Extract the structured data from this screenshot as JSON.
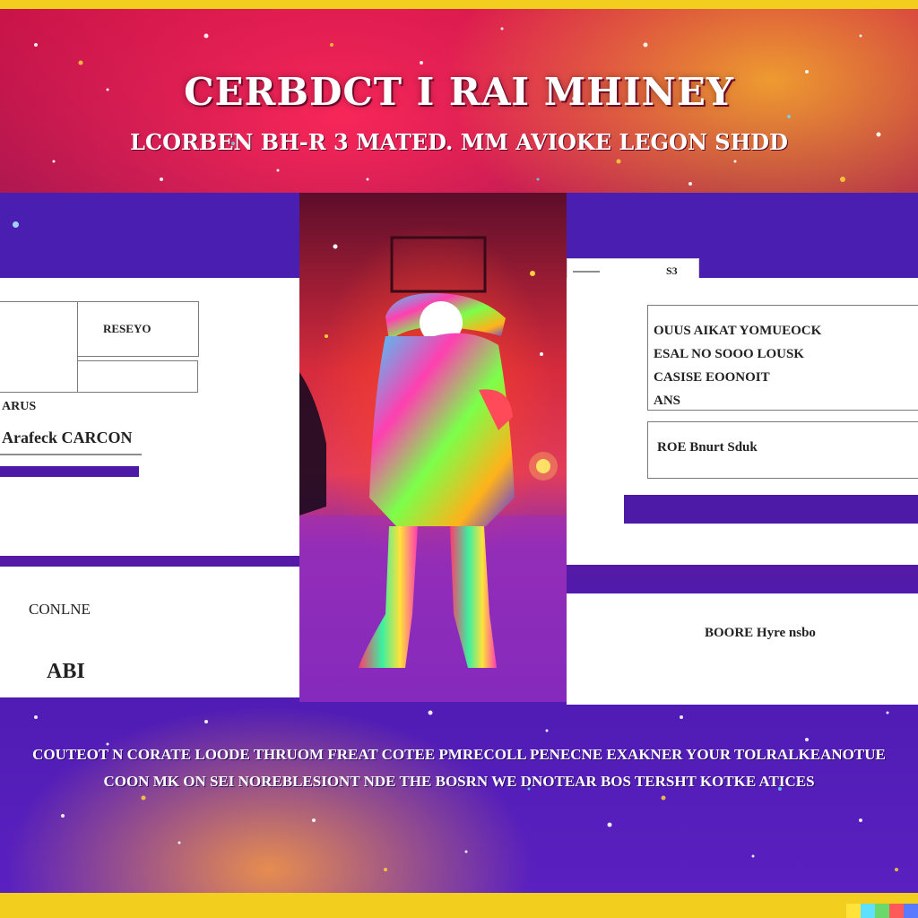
{
  "header": {
    "title": "CERBDCT I RAI MHINEY",
    "subtitle": "LCORBEN  BH-R 3 MATED. MM AVIOKE LEGON SHDD"
  },
  "left_card": {
    "field_label": "RESEYO",
    "caption_top": "ARUS",
    "caption_bottom": "Arafeck CARCON"
  },
  "left_lower": {
    "label": "CONLNE",
    "value": "ABI"
  },
  "right_tab": {
    "label": "S3"
  },
  "right_card": {
    "lines": [
      "OUUS AIKAT YOMUEOCK",
      "ESAL NO SOOO LOUSK",
      "CASISE EOONOIT",
      "ANS"
    ],
    "input_text": "ROE Bnurt Sduk"
  },
  "right_lower": {
    "label": "BOORE Hyre nsbo"
  },
  "footer": {
    "line1": "COUTEOT N CORATE LOODE THRUOM  FREAT   COTEE PMRECOLL PENECNE EXAKNER YOUR TOLRALKEANOTUE",
    "line2": "COON MK ON  SEI NOREBLESIONT  NDE THE BOSRN   WE DNOTEAR BOS TERSHT KOTKE ATICES"
  },
  "colors": {
    "accent_purple": "#4d1aa8",
    "frame_yellow": "#f2cf1e",
    "card_white": "#ffffff"
  }
}
